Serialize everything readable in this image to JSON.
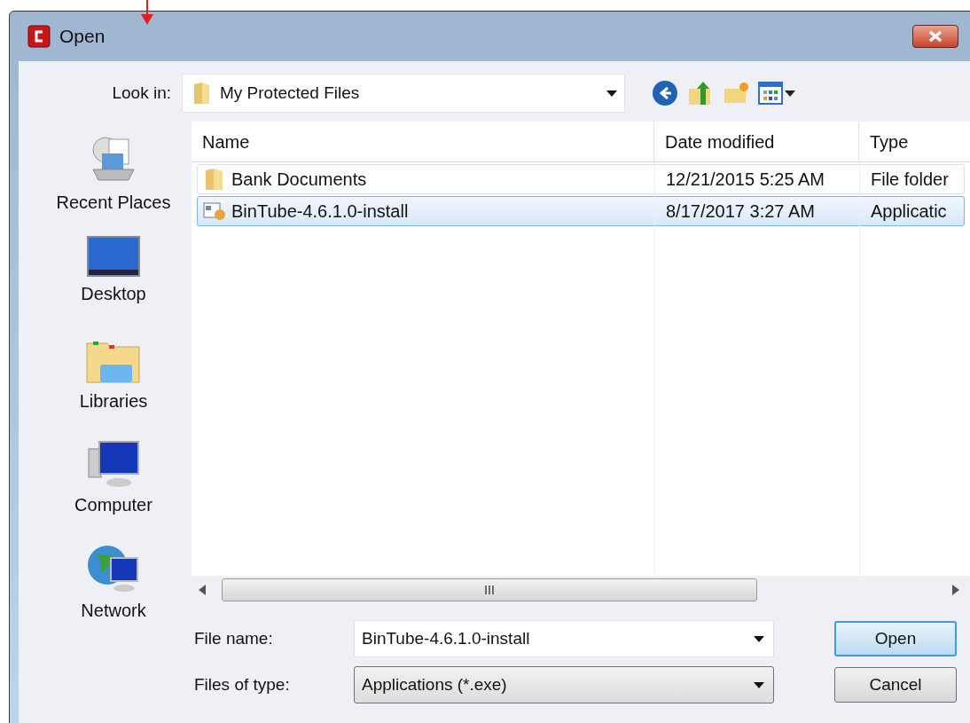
{
  "window": {
    "title": "Open"
  },
  "look_in": {
    "label": "Look in:",
    "value": "My Protected Files"
  },
  "places": [
    {
      "label": "Recent Places",
      "kind": "recent"
    },
    {
      "label": "Desktop",
      "kind": "desktop"
    },
    {
      "label": "Libraries",
      "kind": "libraries"
    },
    {
      "label": "Computer",
      "kind": "computer"
    },
    {
      "label": "Network",
      "kind": "network"
    }
  ],
  "table": {
    "columns": [
      "Name",
      "Date modified",
      "Type"
    ],
    "rows": [
      {
        "kind": "folder",
        "selected": false,
        "cells": [
          "Bank Documents",
          "12/21/2015 5:25 AM",
          "File folder"
        ]
      },
      {
        "kind": "app",
        "selected": true,
        "cells": [
          "BinTube-4.6.1.0-install",
          "8/17/2017 3:27 AM",
          "Applicatic"
        ]
      }
    ]
  },
  "file_name": {
    "label": "File name:",
    "value": "BinTube-4.6.1.0-install"
  },
  "file_type": {
    "label": "Files of type:",
    "value": "Applications (*.exe)"
  },
  "buttons": [
    "Open",
    "Cancel"
  ]
}
